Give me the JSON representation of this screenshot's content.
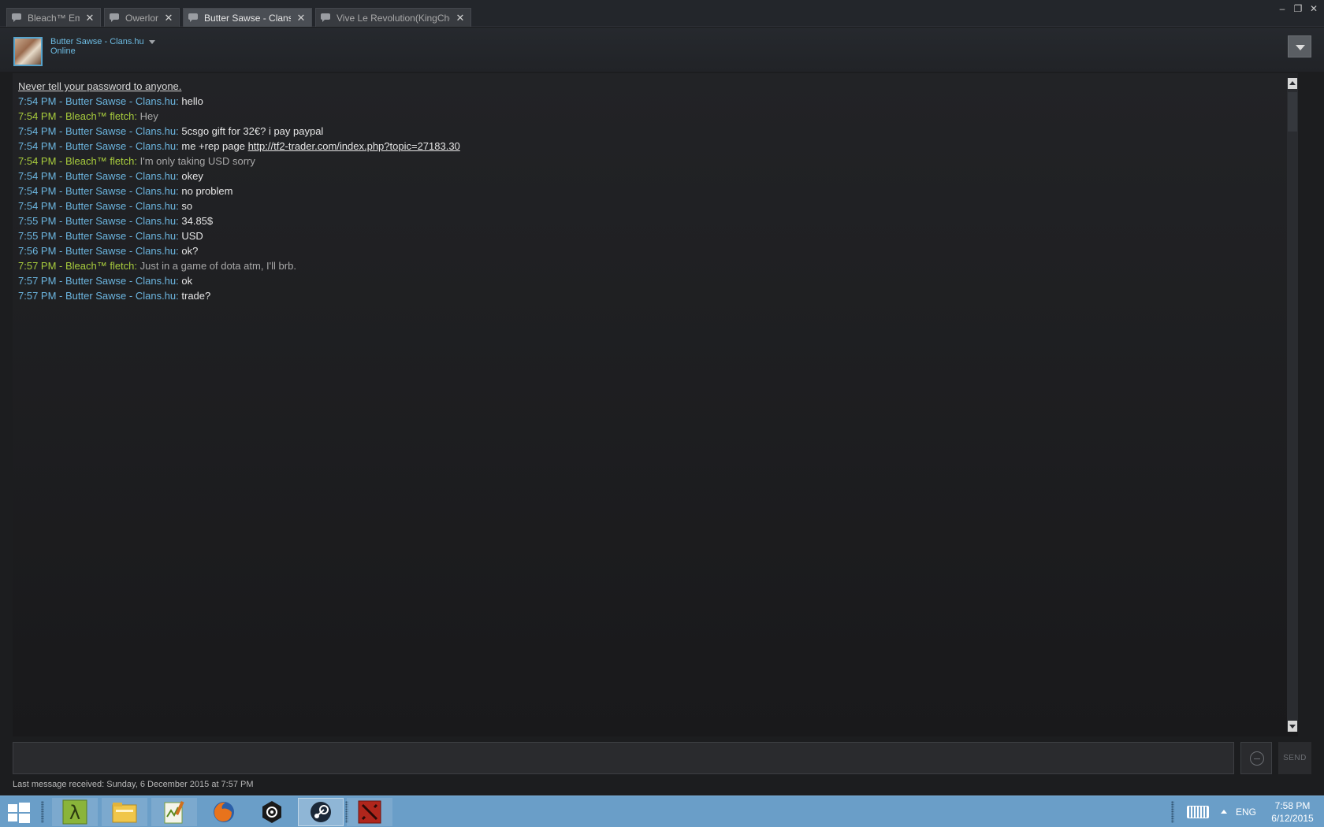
{
  "tabs": [
    {
      "label": "Bleach™ Emu",
      "active": false
    },
    {
      "label": "Owerlord",
      "active": false
    },
    {
      "label": "Butter Sawse - Clans.hu",
      "active": true
    },
    {
      "label": "Vive Le Revolution(KingCherry)",
      "active": false
    }
  ],
  "window_controls": {
    "minimize": "–",
    "maximize": "❐",
    "close": "✕"
  },
  "friend": {
    "name": "Butter Sawse - Clans.hu",
    "status": "Online"
  },
  "warning": "Never tell your password to anyone.",
  "messages": [
    {
      "time": "7:54 PM",
      "sender": "Butter Sawse - Clans.hu",
      "me": true,
      "text": "hello",
      "link": ""
    },
    {
      "time": "7:54 PM",
      "sender": "Bleach™ fletch",
      "me": false,
      "text": "Hey",
      "link": ""
    },
    {
      "time": "7:54 PM",
      "sender": "Butter Sawse - Clans.hu",
      "me": true,
      "text": "5csgo gift for 32€? i pay paypal",
      "link": ""
    },
    {
      "time": "7:54 PM",
      "sender": "Butter Sawse - Clans.hu",
      "me": true,
      "text": "me +rep page ",
      "link": "http://tf2-trader.com/index.php?topic=27183.30"
    },
    {
      "time": "7:54 PM",
      "sender": "Bleach™ fletch",
      "me": false,
      "text": "I'm only taking USD sorry",
      "link": ""
    },
    {
      "time": "7:54 PM",
      "sender": "Butter Sawse - Clans.hu",
      "me": true,
      "text": "okey",
      "link": ""
    },
    {
      "time": "7:54 PM",
      "sender": "Butter Sawse - Clans.hu",
      "me": true,
      "text": "no problem",
      "link": ""
    },
    {
      "time": "7:54 PM",
      "sender": "Butter Sawse - Clans.hu",
      "me": true,
      "text": "so",
      "link": ""
    },
    {
      "time": "7:55 PM",
      "sender": "Butter Sawse - Clans.hu",
      "me": true,
      "text": "34.85$",
      "link": ""
    },
    {
      "time": "7:55 PM",
      "sender": "Butter Sawse - Clans.hu",
      "me": true,
      "text": "USD",
      "link": ""
    },
    {
      "time": "7:56 PM",
      "sender": "Butter Sawse - Clans.hu",
      "me": true,
      "text": "ok?",
      "link": ""
    },
    {
      "time": "7:57 PM",
      "sender": "Bleach™ fletch",
      "me": false,
      "text": "Just in a game of dota atm, I'll brb.",
      "link": ""
    },
    {
      "time": "7:57 PM",
      "sender": "Butter Sawse - Clans.hu",
      "me": true,
      "text": "ok",
      "link": ""
    },
    {
      "time": "7:57 PM",
      "sender": "Butter Sawse - Clans.hu",
      "me": true,
      "text": "trade?",
      "link": ""
    }
  ],
  "input": {
    "value": "",
    "send_label": "SEND"
  },
  "last_received": "Last message received: Sunday, 6 December 2015 at 7:57 PM",
  "colors": {
    "me": "#6cb6e0",
    "them": "#a8cc3d",
    "accent": "#57a3cc",
    "taskbar": "#6a9ec8"
  },
  "taskbar": {
    "apps": [
      {
        "icon": "half-life-icon",
        "state": "pinned"
      },
      {
        "icon": "file-explorer-icon",
        "state": "pinned"
      },
      {
        "icon": "notepad-plus-plus-icon",
        "state": "pinned"
      },
      {
        "icon": "firefox-icon",
        "state": "normal"
      },
      {
        "icon": "unity-icon",
        "state": "normal"
      },
      {
        "icon": "steam-icon",
        "state": "active"
      },
      {
        "icon": "dota2-icon",
        "state": "pinned"
      }
    ],
    "lang": "ENG",
    "time": "7:58 PM",
    "date": "6/12/2015"
  }
}
